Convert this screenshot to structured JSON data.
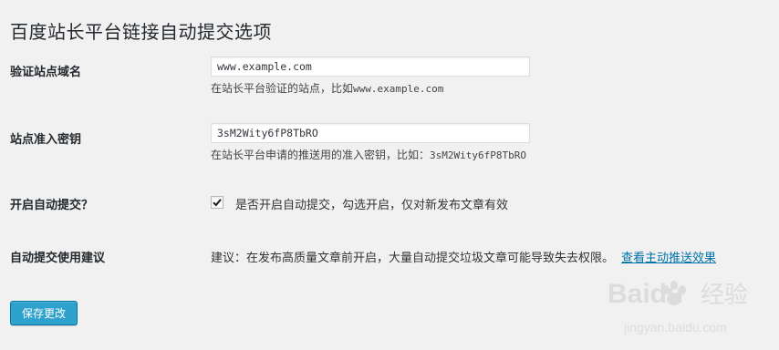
{
  "page": {
    "title": "百度站长平台链接自动提交选项"
  },
  "fields": {
    "domain": {
      "label": "验证站点域名",
      "value": "www.example.com",
      "hint_prefix": "在站长平台验证的站点，比如",
      "hint_example": "www.example.com"
    },
    "token": {
      "label": "站点准入密钥",
      "value": "3sM2Wity6fP8TbRO",
      "hint_prefix": "在站长平台申请的推送用的准入密钥，比如：",
      "hint_example": "3sM2Wity6fP8TbRO"
    },
    "auto_submit": {
      "label": "开启自动提交？",
      "checked": true,
      "text": "是否开启自动提交，勾选开启，仅对新发布文章有效"
    },
    "suggestion": {
      "label": "自动提交使用建议",
      "text": "建议：在发布高质量文章前开启，大量自动提交垃圾文章可能导致失去权限。",
      "link": "查看主动推送效果"
    }
  },
  "actions": {
    "save_label": "保存更改"
  },
  "watermark": {
    "brand": "Baidu",
    "brand_cn": "经验",
    "site": "jingyan.baidu.com"
  },
  "colors": {
    "accent": "#2ea2cc",
    "link": "#0073aa",
    "background": "#f1f1f1"
  }
}
